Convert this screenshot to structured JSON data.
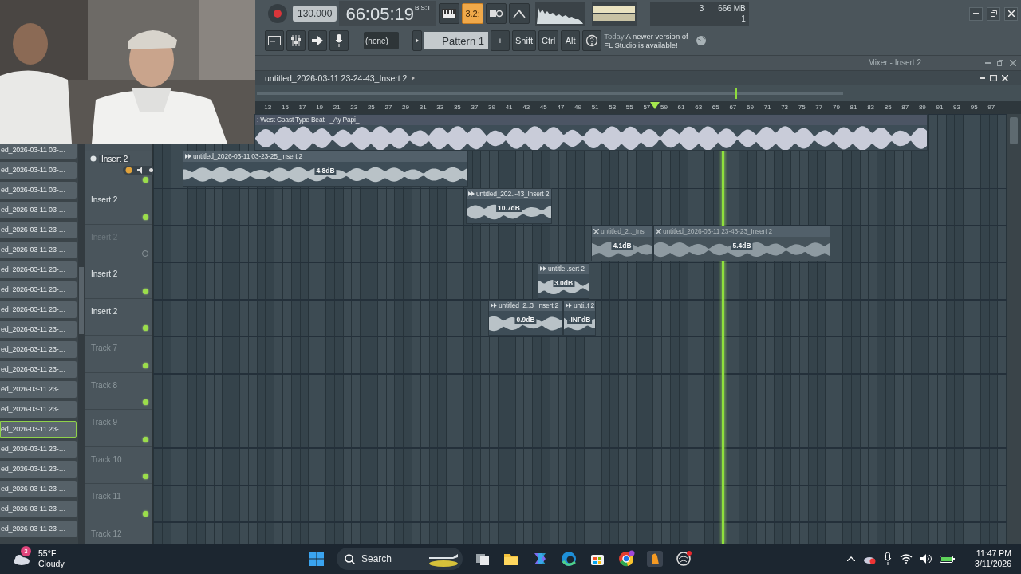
{
  "toolbar": {
    "tempo": "130.000",
    "time": "66:05:19",
    "time_units": "B:S:T",
    "snap": "3.2:",
    "pattern_selector": "(none)",
    "pattern": "Pattern 1",
    "pattern_add": "+",
    "keys": [
      "Shift",
      "Ctrl",
      "Alt"
    ],
    "hint_title": "Today",
    "hint_text": "A newer version of FL Studio is available!",
    "cpu_count": "3",
    "memory": "666 MB",
    "polyphony": "1"
  },
  "mixer_window": {
    "title": "Mixer - Insert 2"
  },
  "browser": {
    "items": [
      {
        "label": "ed_2026-03-11 03-…",
        "selected": false
      },
      {
        "label": "ed_2026-03-11 03-…",
        "selected": false
      },
      {
        "label": "ed_2026-03-11 03-…",
        "selected": false
      },
      {
        "label": "ed_2026-03-11 03-…",
        "selected": false
      },
      {
        "label": "ed_2026-03-11 23-…",
        "selected": false
      },
      {
        "label": "ed_2026-03-11 23-…",
        "selected": false
      },
      {
        "label": "ed_2026-03-11 23-…",
        "selected": false
      },
      {
        "label": "ed_2026-03-11 23-…",
        "selected": false
      },
      {
        "label": "ed_2026-03-11 23-…",
        "selected": false
      },
      {
        "label": "ed_2026-03-11 23-…",
        "selected": false
      },
      {
        "label": "ed_2026-03-11 23-…",
        "selected": false
      },
      {
        "label": "ed_2026-03-11 23-…",
        "selected": false
      },
      {
        "label": "ed_2026-03-11 23-…",
        "selected": false
      },
      {
        "label": "ed_2026-03-11 23-…",
        "selected": false
      },
      {
        "label": "ed_2026-03-11 23-…",
        "selected": true
      },
      {
        "label": "ed_2026-03-11 23-…",
        "selected": false
      },
      {
        "label": "ed_2026-03-11 23-…",
        "selected": false
      },
      {
        "label": "ed_2026-03-11 23-…",
        "selected": false
      },
      {
        "label": "ed_2026-03-11 23-…",
        "selected": false
      },
      {
        "label": "ed_2026-03-11 23-…",
        "selected": false
      }
    ]
  },
  "playlist": {
    "title": "untitled_2026-03-11 23-24-43_Insert 2",
    "ruler": [
      "13",
      "15",
      "17",
      "19",
      "21",
      "23",
      "25",
      "27",
      "29",
      "31",
      "33",
      "35",
      "37",
      "39",
      "41",
      "43",
      "45",
      "47",
      "49",
      "51",
      "53",
      "55",
      "57",
      "59",
      "61",
      "63",
      "65",
      "67",
      "69",
      "71",
      "73",
      "75",
      "77",
      "79",
      "81",
      "83",
      "85",
      "87",
      "89",
      "91",
      "93",
      "95",
      "97"
    ],
    "tracks": [
      {
        "label": "Insert 2",
        "kind": "audio",
        "muted": false,
        "selected": true
      },
      {
        "label": "Insert 2",
        "kind": "audio",
        "muted": false,
        "selected": false
      },
      {
        "label": "Insert 2",
        "kind": "audio",
        "muted": true,
        "selected": false
      },
      {
        "label": "Insert 2",
        "kind": "audio",
        "muted": false,
        "selected": false
      },
      {
        "label": "Insert 2",
        "kind": "audio",
        "muted": false,
        "selected": false
      },
      {
        "label": "Track 7",
        "kind": "empty",
        "muted": false,
        "selected": false
      },
      {
        "label": "Track 8",
        "kind": "empty",
        "muted": false,
        "selected": false
      },
      {
        "label": "Track 9",
        "kind": "empty",
        "muted": false,
        "selected": false
      },
      {
        "label": "Track 10",
        "kind": "empty",
        "muted": false,
        "selected": false
      },
      {
        "label": "Track 11",
        "kind": "empty",
        "muted": false,
        "selected": false
      },
      {
        "label": "Track 12",
        "kind": "empty",
        "selected": false
      }
    ],
    "clips": [
      {
        "title": ": West Coast Type Beat - _Ay Papi_",
        "muted": false
      },
      {
        "title": "untitled_2026-03-11 03-23-25_Insert 2",
        "gain": "4.8dB",
        "muted": false
      },
      {
        "title": "untitled_202..-43_Insert 2",
        "gain": "10.7dB",
        "muted": false
      },
      {
        "title": "untitled_2.._Ins",
        "gain": "4.1dB",
        "muted": true
      },
      {
        "title": "untitled_2026-03-11 23-43-23_Insert 2",
        "gain": "5.4dB",
        "muted": true
      },
      {
        "title": "untitle..sert 2",
        "gain": "3.0dB",
        "muted": false
      },
      {
        "title": "untitled_2..3_Insert 2",
        "gain": "0.9dB",
        "muted": false
      },
      {
        "title": "unti..t 2",
        "gain": "-INFdB",
        "muted": false
      }
    ]
  },
  "taskbar": {
    "weather_badge": "3",
    "temperature": "55°F",
    "condition": "Cloudy",
    "search": "Search",
    "time": "11:47 PM",
    "date": "3/11/2026"
  }
}
